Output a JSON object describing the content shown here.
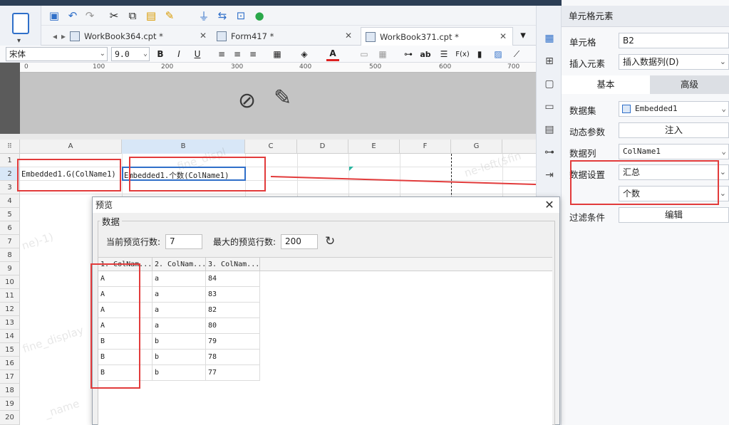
{
  "tabs": [
    {
      "label": "WorkBook364.cpt *"
    },
    {
      "label": "Form417 *"
    },
    {
      "label": "WorkBook371.cpt *"
    }
  ],
  "format_toolbar": {
    "font_name": "宋体",
    "font_size": "9.0",
    "bold": "B",
    "italic": "I",
    "underline": "U",
    "text_icon": "ab",
    "formula_icon": "F(x)"
  },
  "ruler": {
    "ticks": [
      "0",
      "100",
      "200",
      "300",
      "400",
      "500",
      "600",
      "700"
    ]
  },
  "sheet": {
    "columns": [
      "A",
      "B",
      "C",
      "D",
      "E",
      "F",
      "G"
    ],
    "rows": [
      "1",
      "2",
      "3",
      "4",
      "5",
      "6",
      "7",
      "8",
      "9",
      "10",
      "11",
      "12",
      "13",
      "14",
      "15",
      "16",
      "17",
      "18",
      "19",
      "20"
    ],
    "cell_A2": "Embedded1.G(ColName1)",
    "cell_B2": "Embedded1.个数(ColName1)"
  },
  "watermarks": [
    "_fine_displ",
    "ne-left($fin",
    "ne)-1)",
    "fine_display",
    "_name"
  ],
  "panel": {
    "title": "单元格元素",
    "cell_label": "单元格",
    "cell_value": "B2",
    "insert_label": "插入元素",
    "insert_value": "插入数据列(D)",
    "tab_basic": "基本",
    "tab_advanced": "高级",
    "dataset_label": "数据集",
    "dataset_value": "Embedded1",
    "dynamic_label": "动态参数",
    "dynamic_button": "注入",
    "column_label": "数据列",
    "column_value": "ColName1",
    "setting_label": "数据设置",
    "setting_value": "汇总",
    "setting_sub": "个数",
    "filter_label": "过滤条件",
    "filter_button": "编辑"
  },
  "dialog": {
    "title": "预览",
    "group": "数据",
    "current_rows_label": "当前预览行数:",
    "current_rows": "7",
    "max_rows_label": "最大的预览行数:",
    "max_rows": "200",
    "headers": [
      "1. ColNam...",
      "2. ColNam...",
      "3. ColNam..."
    ],
    "rows": [
      [
        "A",
        "a",
        "84"
      ],
      [
        "A",
        "a",
        "83"
      ],
      [
        "A",
        "a",
        "82"
      ],
      [
        "A",
        "a",
        "80"
      ],
      [
        "B",
        "b",
        "79"
      ],
      [
        "B",
        "b",
        "78"
      ],
      [
        "B",
        "b",
        "77"
      ]
    ]
  },
  "colors": {
    "accent": "#2f6fc9",
    "highlight": "#e23b3b",
    "panel_bg": "#f7f8fa"
  }
}
